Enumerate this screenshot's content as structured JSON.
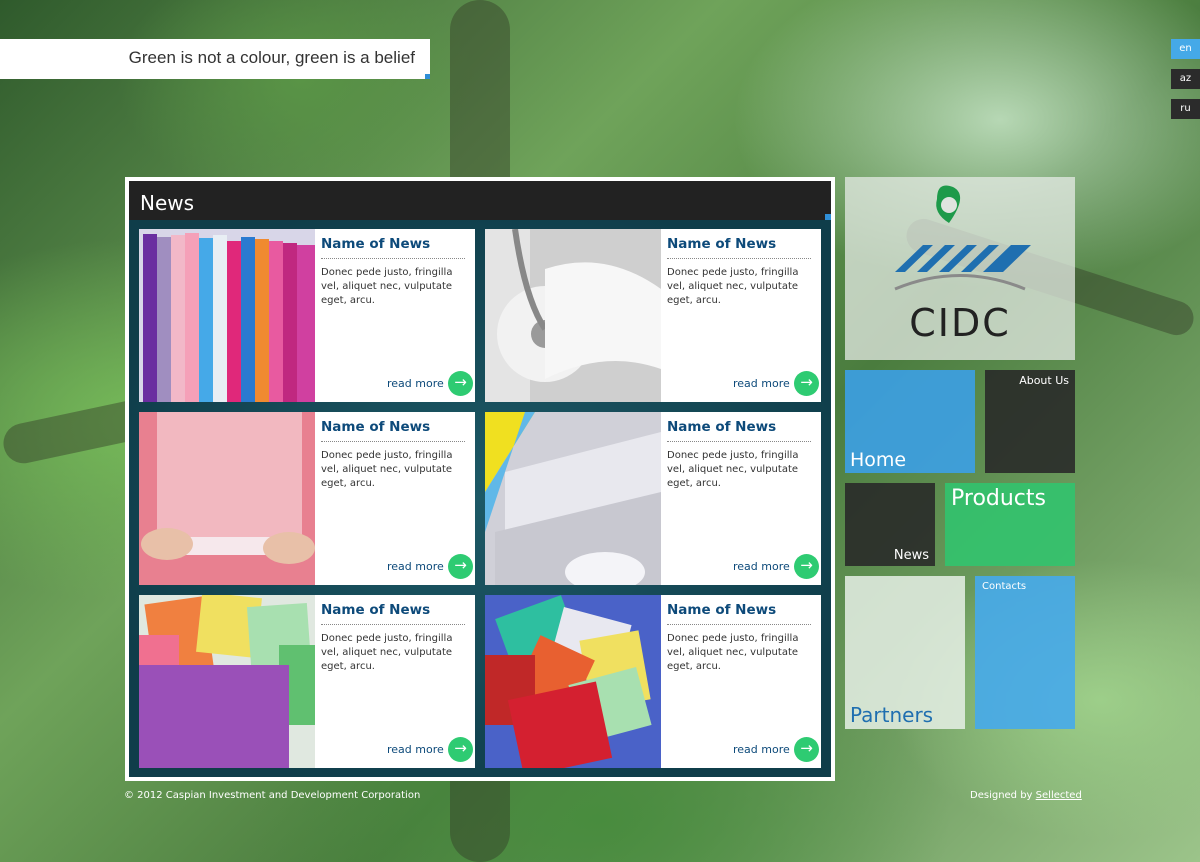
{
  "slogan": "Green is not a colour, green is a belief",
  "languages": [
    {
      "code": "en",
      "active": true
    },
    {
      "code": "az",
      "active": false
    },
    {
      "code": "ru",
      "active": false
    }
  ],
  "news": {
    "title": "News",
    "read_more": "read more",
    "items": [
      {
        "title": "Name of News",
        "desc": "Donec pede justo, fringilla vel, aliquet nec, vulputate eget, arcu.",
        "image": "colored-paper-rolls"
      },
      {
        "title": "Name of News",
        "desc": "Donec pede justo, fringilla vel, aliquet nec, vulputate eget, arcu.",
        "image": "toilet-paper-holder"
      },
      {
        "title": "Name of News",
        "desc": "Donec pede justo, fringilla vel, aliquet nec, vulputate eget, arcu.",
        "image": "hands-pink-paper"
      },
      {
        "title": "Name of News",
        "desc": "Donec pede justo, fringilla vel, aliquet nec, vulputate eget, arcu.",
        "image": "paper-towel-rolls"
      },
      {
        "title": "Name of News",
        "desc": "Donec pede justo, fringilla vel, aliquet nec, vulputate eget, arcu.",
        "image": "tissue-paper-sheets"
      },
      {
        "title": "Name of News",
        "desc": "Donec pede justo, fringilla vel, aliquet nec, vulputate eget, arcu.",
        "image": "colored-napkins"
      }
    ]
  },
  "logo": {
    "text": "CIDC",
    "colors": {
      "green": "#1e9a4a",
      "blue": "#1f6fb0"
    }
  },
  "nav": {
    "home": "Home",
    "about": "About Us",
    "news": "News",
    "products": "Products",
    "partners": "Partners",
    "contacts": "Contacts"
  },
  "footer": {
    "copyright": "© 2012 Caspian Investment and Development Corporation",
    "designed_by": "Designed by",
    "designer": "Sellected"
  },
  "colors": {
    "accent_blue": "#45a9e8",
    "accent_green": "#2ecb72",
    "title_blue": "#0d4a7a",
    "dark": "#222222"
  }
}
